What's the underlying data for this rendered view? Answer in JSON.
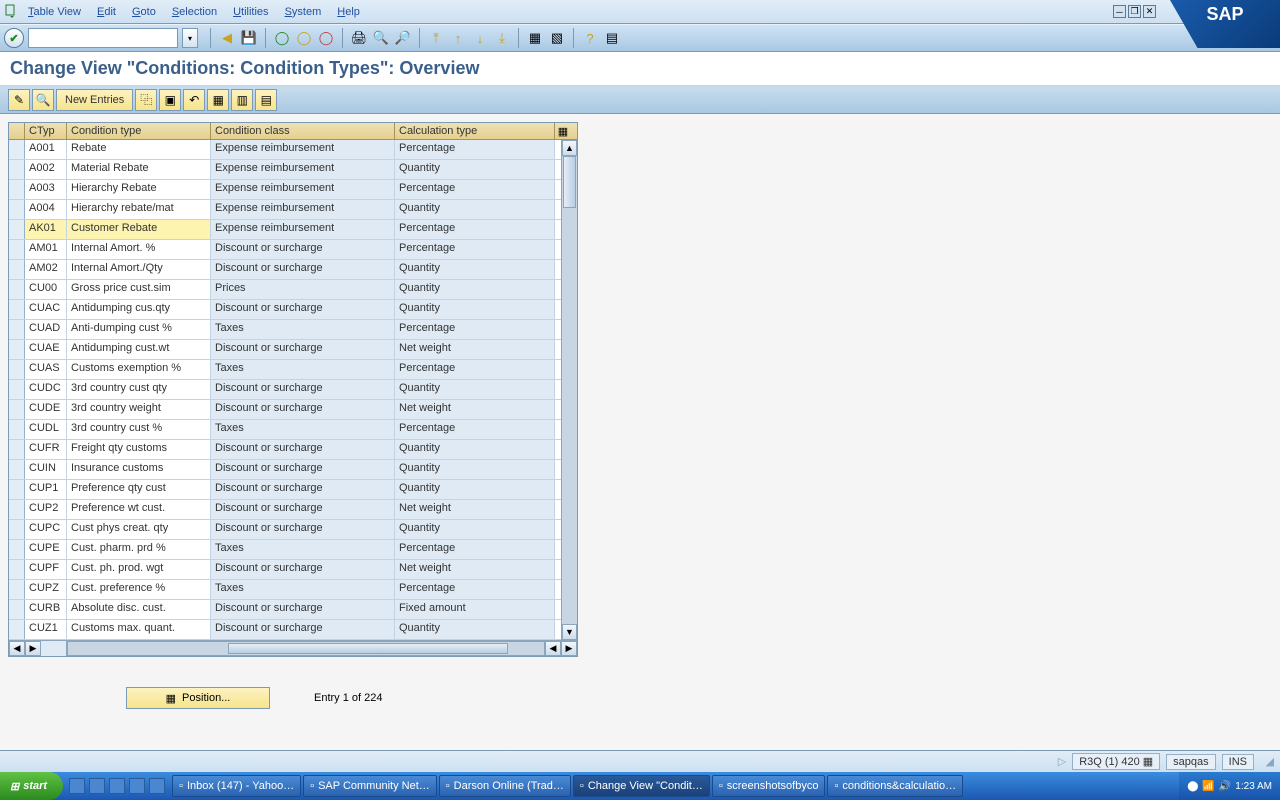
{
  "menu": {
    "items": [
      "Table View",
      "Edit",
      "Goto",
      "Selection",
      "Utilities",
      "System",
      "Help"
    ]
  },
  "title": "Change View \"Conditions: Condition Types\": Overview",
  "apptoolbar": {
    "new_entries": "New Entries"
  },
  "columns": {
    "ctyp": "CTyp",
    "ctype": "Condition type",
    "cclass": "Condition class",
    "calc": "Calculation type"
  },
  "rows": [
    {
      "c": "A001",
      "t": "Rebate",
      "cl": "Expense reimbursement",
      "ca": "Percentage"
    },
    {
      "c": "A002",
      "t": "Material Rebate",
      "cl": "Expense reimbursement",
      "ca": "Quantity"
    },
    {
      "c": "A003",
      "t": "Hierarchy Rebate",
      "cl": "Expense reimbursement",
      "ca": "Percentage"
    },
    {
      "c": "A004",
      "t": "Hierarchy rebate/mat",
      "cl": "Expense reimbursement",
      "ca": "Quantity"
    },
    {
      "c": "AK01",
      "t": "Customer Rebate",
      "cl": "Expense reimbursement",
      "ca": "Percentage",
      "sel": true
    },
    {
      "c": "AM01",
      "t": "Internal Amort. %",
      "cl": "Discount or surcharge",
      "ca": "Percentage"
    },
    {
      "c": "AM02",
      "t": "Internal Amort./Qty",
      "cl": "Discount or surcharge",
      "ca": "Quantity"
    },
    {
      "c": "CU00",
      "t": "Gross price cust.sim",
      "cl": "Prices",
      "ca": "Quantity"
    },
    {
      "c": "CUAC",
      "t": "Antidumping cus.qty",
      "cl": "Discount or surcharge",
      "ca": "Quantity"
    },
    {
      "c": "CUAD",
      "t": "Anti-dumping cust %",
      "cl": "Taxes",
      "ca": "Percentage"
    },
    {
      "c": "CUAE",
      "t": "Antidumping cust.wt",
      "cl": "Discount or surcharge",
      "ca": "Net weight"
    },
    {
      "c": "CUAS",
      "t": "Customs exemption %",
      "cl": "Taxes",
      "ca": "Percentage"
    },
    {
      "c": "CUDC",
      "t": "3rd country cust qty",
      "cl": "Discount or surcharge",
      "ca": "Quantity"
    },
    {
      "c": "CUDE",
      "t": "3rd country weight",
      "cl": "Discount or surcharge",
      "ca": "Net weight"
    },
    {
      "c": "CUDL",
      "t": "3rd country cust %",
      "cl": "Taxes",
      "ca": "Percentage"
    },
    {
      "c": "CUFR",
      "t": "Freight qty customs",
      "cl": "Discount or surcharge",
      "ca": "Quantity"
    },
    {
      "c": "CUIN",
      "t": "Insurance customs",
      "cl": "Discount or surcharge",
      "ca": "Quantity"
    },
    {
      "c": "CUP1",
      "t": "Preference qty cust",
      "cl": "Discount or surcharge",
      "ca": "Quantity"
    },
    {
      "c": "CUP2",
      "t": "Preference wt cust.",
      "cl": "Discount or surcharge",
      "ca": "Net weight"
    },
    {
      "c": "CUPC",
      "t": "Cust phys creat. qty",
      "cl": "Discount or surcharge",
      "ca": "Quantity"
    },
    {
      "c": "CUPE",
      "t": "Cust. pharm. prd %",
      "cl": "Taxes",
      "ca": "Percentage"
    },
    {
      "c": "CUPF",
      "t": "Cust. ph. prod. wgt",
      "cl": "Discount or surcharge",
      "ca": "Net weight"
    },
    {
      "c": "CUPZ",
      "t": "Cust. preference %",
      "cl": "Taxes",
      "ca": "Percentage"
    },
    {
      "c": "CURB",
      "t": "Absolute disc. cust.",
      "cl": "Discount or surcharge",
      "ca": "Fixed amount"
    },
    {
      "c": "CUZ1",
      "t": "Customs max. quant.",
      "cl": "Discount or surcharge",
      "ca": "Quantity"
    }
  ],
  "position_btn": "Position...",
  "entry_info": "Entry 1 of 224",
  "status": {
    "system": "R3Q (1) 420",
    "server": "sapqas",
    "mode": "INS"
  },
  "taskbar": {
    "start": "start",
    "items": [
      "Inbox (147) - Yahoo…",
      "SAP Community Net…",
      "Darson Online (Trad…",
      "Change View \"Condit…",
      "screenshotsofbyco",
      "conditions&calculatio…"
    ],
    "time": "1:23 AM"
  },
  "sap_logo": "SAP"
}
